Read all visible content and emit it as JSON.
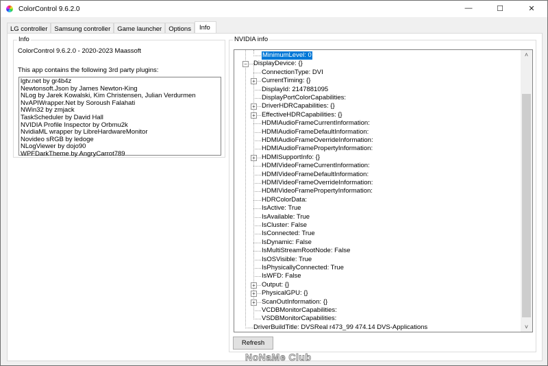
{
  "window": {
    "title": "ColorControl 9.6.2.0",
    "minimize": "—",
    "maximize": "☐",
    "close": "✕"
  },
  "tabs": [
    "LG controller",
    "Samsung controller",
    "Game launcher",
    "Options",
    "Info"
  ],
  "info": {
    "group_label": "Info",
    "version_line": "ColorControl 9.6.2.0 - 2020-2023 Maassoft",
    "plugins_label": "This app contains the following 3rd party plugins:",
    "plugins": [
      "lgtv.net by gr4b4z",
      "Newtonsoft.Json by James Newton-King",
      "NLog by Jarek Kowalski, Kim Christensen, Julian Verdurmen",
      "NvAPIWrapper.Net by Soroush Falahati",
      "NWin32 by zmjack",
      "TaskScheduler by David Hall",
      "NVIDIA Profile Inspector by Orbmu2k",
      "NvidiaML wrapper by LibreHardwareMonitor",
      "Novideo sRGB by ledoge",
      "NLogViewer by dojo90",
      "WPFDarkTheme by AngryCarrot789"
    ]
  },
  "nvidia": {
    "group_label": "NVIDIA info",
    "refresh_label": "Refresh",
    "tree": [
      {
        "text": "MinimumLevel: 0",
        "level": 3,
        "selected": true,
        "last": true
      },
      {
        "text": "DisplayDevice: {}",
        "level": 2,
        "expander": "-"
      },
      {
        "text": "ConnectionType: DVI",
        "level": 3
      },
      {
        "text": "CurrentTiming: {}",
        "level": 3,
        "expander": "+"
      },
      {
        "text": "DisplayId: 2147881095",
        "level": 3
      },
      {
        "text": "DisplayPortColorCapabilities:",
        "level": 3
      },
      {
        "text": "DriverHDRCapabilities: {}",
        "level": 3,
        "expander": "+"
      },
      {
        "text": "EffectiveHDRCapabilities: {}",
        "level": 3,
        "expander": "+"
      },
      {
        "text": "HDMIAudioFrameCurrentInformation:",
        "level": 3
      },
      {
        "text": "HDMIAudioFrameDefaultInformation:",
        "level": 3
      },
      {
        "text": "HDMIAudioFrameOverrideInformation:",
        "level": 3
      },
      {
        "text": "HDMIAudioFramePropertyInformation:",
        "level": 3
      },
      {
        "text": "HDMISupportInfo: {}",
        "level": 3,
        "expander": "+"
      },
      {
        "text": "HDMIVideoFrameCurrentInformation:",
        "level": 3
      },
      {
        "text": "HDMIVideoFrameDefaultInformation:",
        "level": 3
      },
      {
        "text": "HDMIVideoFrameOverrideInformation:",
        "level": 3
      },
      {
        "text": "HDMIVideoFramePropertyInformation:",
        "level": 3
      },
      {
        "text": "HDRColorData:",
        "level": 3
      },
      {
        "text": "IsActive: True",
        "level": 3
      },
      {
        "text": "IsAvailable: True",
        "level": 3
      },
      {
        "text": "IsCluster: False",
        "level": 3
      },
      {
        "text": "IsConnected: True",
        "level": 3
      },
      {
        "text": "IsDynamic: False",
        "level": 3
      },
      {
        "text": "IsMultiStreamRootNode: False",
        "level": 3
      },
      {
        "text": "IsOSVisible: True",
        "level": 3
      },
      {
        "text": "IsPhysicallyConnected: True",
        "level": 3
      },
      {
        "text": "IsWFD: False",
        "level": 3
      },
      {
        "text": "Output: {}",
        "level": 3,
        "expander": "+"
      },
      {
        "text": "PhysicalGPU: {}",
        "level": 3,
        "expander": "+"
      },
      {
        "text": "ScanOutInformation: {}",
        "level": 3,
        "expander": "+"
      },
      {
        "text": "VCDBMonitorCapabilities:",
        "level": 3
      },
      {
        "text": "VSDBMonitorCapabilities:",
        "level": 3,
        "last": true
      },
      {
        "text": "DriverBuildTitle: DVSReal r473_99 474.14 DVS-Applications",
        "level": 2
      }
    ]
  },
  "watermark": "NoNaMe Club"
}
